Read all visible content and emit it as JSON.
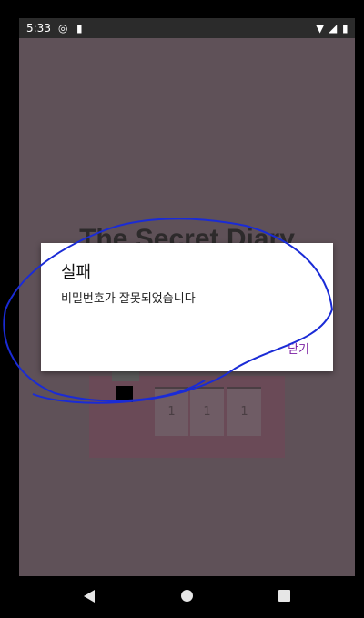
{
  "status_bar": {
    "time": "5:33",
    "icons": [
      "data-saver-icon",
      "sd-card-icon",
      "wifi-icon",
      "signal-icon",
      "battery-icon"
    ]
  },
  "app": {
    "title": "The Secret Diary",
    "digits": [
      "1",
      "1",
      "1"
    ]
  },
  "dialog": {
    "title": "실패",
    "message": "비밀번호가 잘못되었습니다",
    "close_label": "닫기"
  },
  "colors": {
    "scrim_bg": "#5f5158",
    "dialog_button": "#7a1fa2",
    "annotation_stroke": "#1a2bd6"
  }
}
